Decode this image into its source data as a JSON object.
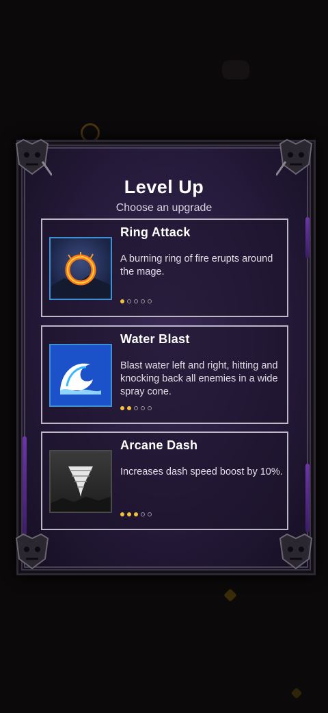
{
  "header": {
    "title": "Level Up",
    "subtitle": "Choose an upgrade"
  },
  "upgrades": [
    {
      "name": "Ring Attack",
      "description": "A burning ring of fire erupts around the mage.",
      "icon": "fire-ring-icon",
      "level": 1,
      "max_level": 5
    },
    {
      "name": "Water Blast",
      "description": "Blast water left and right, hitting and knocking back all enemies in a wide spray cone.",
      "icon": "water-wave-icon",
      "level": 2,
      "max_level": 5
    },
    {
      "name": "Arcane Dash",
      "description": "Increases dash speed boost by 10%.",
      "icon": "tornado-icon",
      "level": 3,
      "max_level": 5
    }
  ],
  "colors": {
    "level_dot_active": "#f3c23b",
    "panel_bg": "#251a3a",
    "card_border": "#bdb8c6"
  }
}
